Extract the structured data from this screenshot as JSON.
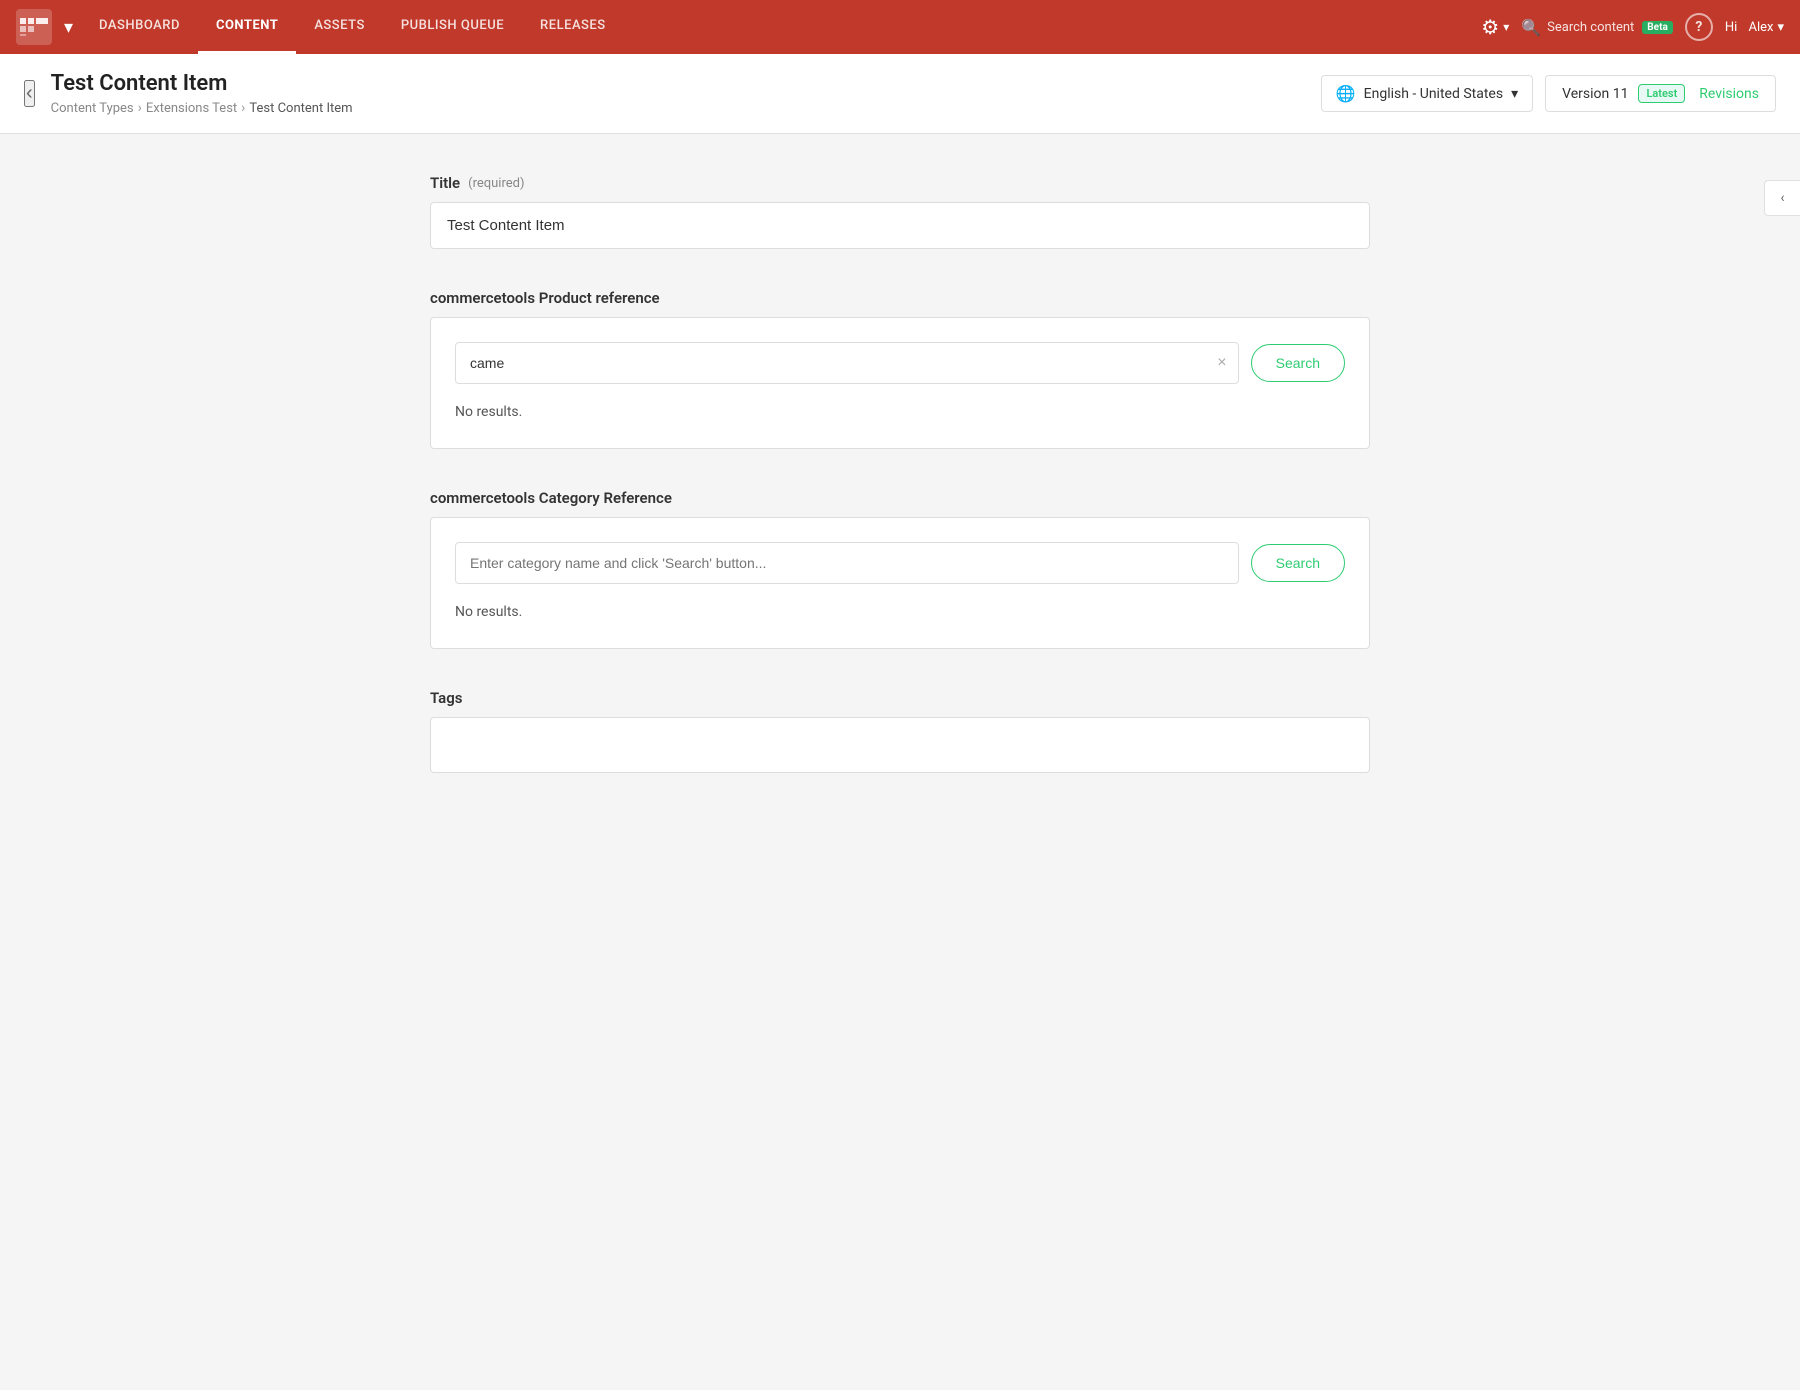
{
  "topnav": {
    "logo_text": "M",
    "nav_items": [
      {
        "label": "Dashboard",
        "key": "dashboard",
        "active": false
      },
      {
        "label": "Content",
        "key": "content",
        "active": true
      },
      {
        "label": "Assets",
        "key": "assets",
        "active": false
      },
      {
        "label": "Publish Queue",
        "key": "publish-queue",
        "active": false
      },
      {
        "label": "Releases",
        "key": "releases",
        "active": false
      }
    ],
    "search_placeholder": "Search content",
    "beta_label": "Beta",
    "help_label": "?",
    "user_greeting": "Hi",
    "user_name": "Alex"
  },
  "header": {
    "page_title": "Test Content Item",
    "breadcrumb": [
      {
        "label": "Content Types"
      },
      {
        "label": "Extensions Test"
      },
      {
        "label": "Test Content Item"
      }
    ],
    "locale": "English - United States",
    "version": "Version 11",
    "latest_badge": "Latest",
    "revisions_label": "Revisions"
  },
  "form": {
    "title_label": "Title",
    "title_required": "(required)",
    "title_value": "Test Content Item",
    "product_ref_label": "commercetools Product reference",
    "product_search_value": "came",
    "product_clear_btn": "×",
    "product_search_btn": "Search",
    "product_no_results": "No results.",
    "category_ref_label": "commercetools Category Reference",
    "category_placeholder": "Enter category name and click 'Search' button...",
    "category_search_btn": "Search",
    "category_no_results": "No results.",
    "tags_label": "Tags"
  },
  "sidebar_toggle": "‹"
}
